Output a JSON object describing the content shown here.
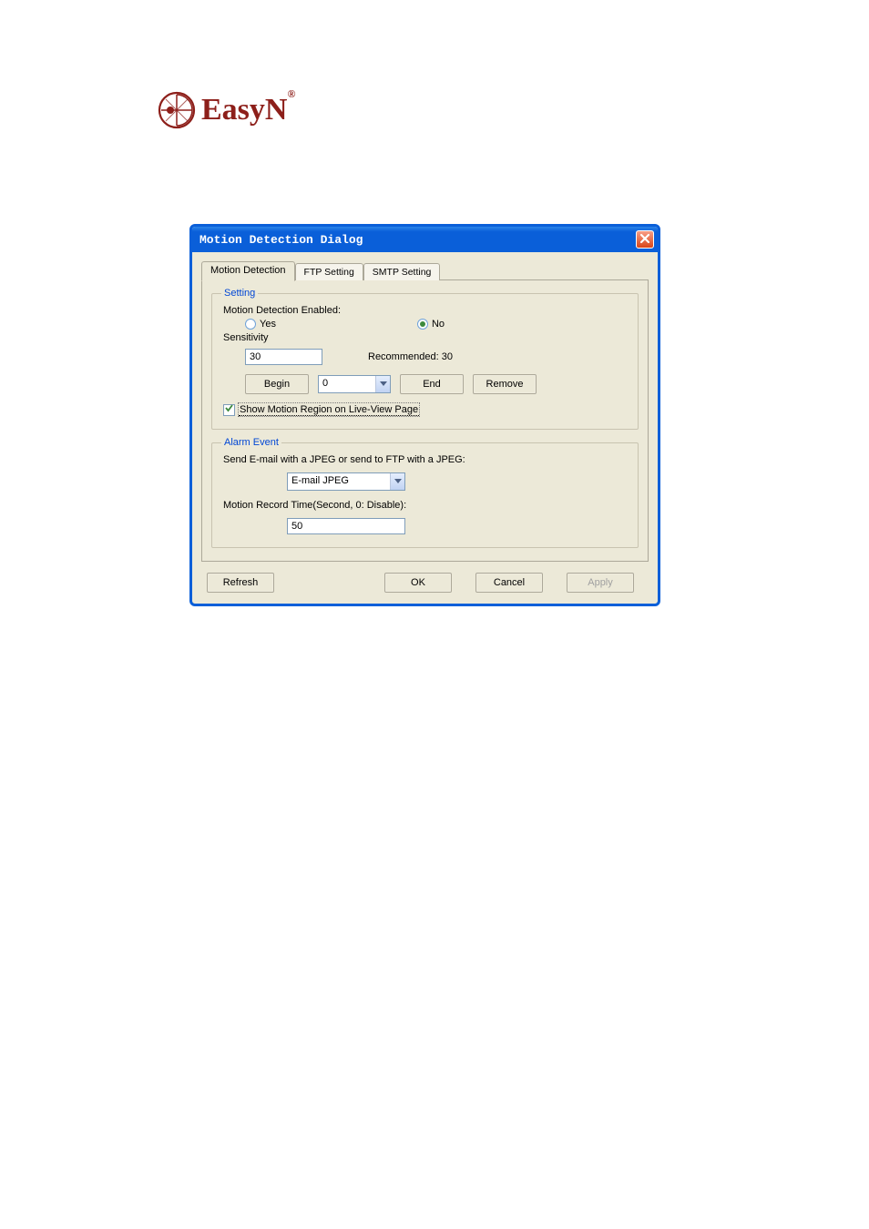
{
  "brand": {
    "name": "EasyN",
    "registered": "®"
  },
  "dialog": {
    "title": "Motion Detection Dialog",
    "tabs": {
      "motion": "Motion Detection",
      "ftp": "FTP Setting",
      "smtp": "SMTP Setting"
    },
    "setting": {
      "legend": "Setting",
      "enabled_label": "Motion Detection Enabled:",
      "yes": "Yes",
      "no": "No",
      "sensitivity_label": "Sensitivity",
      "sensitivity_value": "30",
      "recommended": "Recommended: 30",
      "begin": "Begin",
      "region_value": "0",
      "end": "End",
      "remove": "Remove",
      "show_region": "Show Motion Region on Live-View Page"
    },
    "alarm": {
      "legend": "Alarm Event",
      "send_label": "Send E-mail with a JPEG or send to FTP with a JPEG:",
      "combo_value": "E-mail JPEG",
      "record_label": "Motion Record Time(Second, 0: Disable):",
      "record_value": "50"
    },
    "footer": {
      "refresh": "Refresh",
      "ok": "OK",
      "cancel": "Cancel",
      "apply": "Apply"
    }
  }
}
